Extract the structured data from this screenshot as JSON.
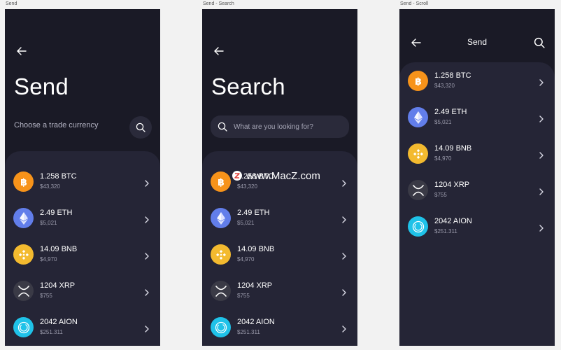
{
  "frames": [
    {
      "label": "Send"
    },
    {
      "label": "Send - Search"
    },
    {
      "label": "Send - Scroll"
    }
  ],
  "screen1": {
    "title": "Send",
    "subtitle": "Choose a trade currency"
  },
  "screen2": {
    "title": "Search",
    "search_placeholder": "What are you looking for?"
  },
  "screen3": {
    "header_title": "Send"
  },
  "coins": [
    {
      "amount": "1.258 BTC",
      "usd": "$43,320",
      "icon": "bitcoin-icon",
      "color": "#f7931a"
    },
    {
      "amount": "2.49 ETH",
      "usd": "$5,021",
      "icon": "ethereum-icon",
      "color": "#627eea"
    },
    {
      "amount": "14.09 BNB",
      "usd": "$4,970",
      "icon": "binance-icon",
      "color": "#f3ba2f"
    },
    {
      "amount": "1204 XRP",
      "usd": "$755",
      "icon": "ripple-icon",
      "color": "#3a3a46"
    },
    {
      "amount": "2042 AION",
      "usd": "$251.311",
      "icon": "aion-icon",
      "color": "#1fc2e8"
    }
  ],
  "watermark": {
    "text": "www.MacZ.com"
  }
}
